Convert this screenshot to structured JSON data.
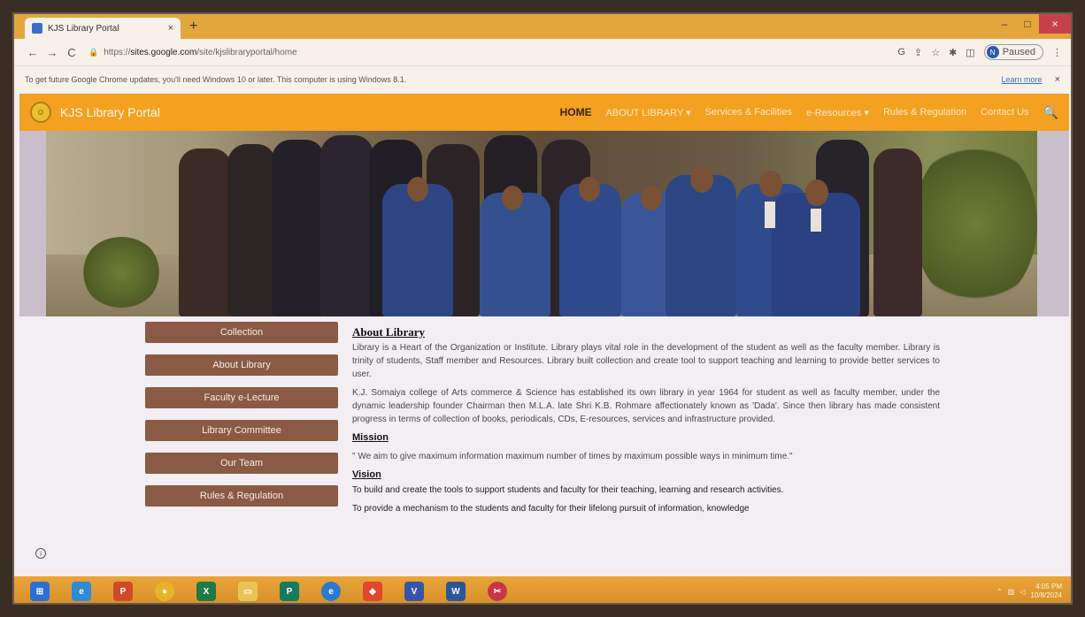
{
  "browser": {
    "tab_title": "KJS Library Portal",
    "tab_close": "×",
    "new_tab": "+",
    "win_minimize": "–",
    "win_maximize": "□",
    "win_close": "×",
    "url_prefix": "https://",
    "url_domain": "sites.google.com",
    "url_path": "/site/kjslibraryportal/home",
    "profile_initial": "N",
    "profile_status": "Paused",
    "info_message": "To get future Google Chrome updates, you'll need Windows 10 or later. This computer is using Windows 8.1.",
    "learn_more": "Learn more"
  },
  "site": {
    "name": "KJS Library Portal",
    "menu": {
      "home": "HOME",
      "about": "ABOUT LIBRARY ▾",
      "services": "Services & Facilities",
      "eresources": "e-Resources ▾",
      "rules": "Rules & Regulation",
      "contact": "Contact Us"
    }
  },
  "sidebar": {
    "items": [
      {
        "label": "Collection"
      },
      {
        "label": "About Library"
      },
      {
        "label": "Faculty e-Lecture"
      },
      {
        "label": "Library Committee"
      },
      {
        "label": "Our Team"
      },
      {
        "label": "Rules & Regulation"
      }
    ]
  },
  "content": {
    "about_heading": "About Library",
    "about_p1": "Library is a Heart of the Organization or Institute. Library plays vital role in the development of the student as well as the faculty member. Library is trinity of students, Staff member and Resources. Library built collection and create tool to support teaching and learning to provide better services to user.",
    "about_p2": "K.J. Somaiya college of Arts commerce & Science has established its own library in year 1964 for student as well as faculty member, under the dynamic leadership founder Chairman then M.L.A. late Shri K.B. Rohmare affectionately known as 'Dada'. Since then library has made consistent progress in terms of collection of books, periodicals, CDs, E-resources, services and infrastructure provided.",
    "mission_heading": "Mission",
    "mission_text": "\" We aim to give maximum information maximum number of times by maximum possible ways in minimum time.\"",
    "vision_heading": "Vision",
    "vision_p1": "To build and create the tools to support students and faculty for their teaching, learning and research activities.",
    "vision_p2": "To provide a mechanism to the students and faculty for their lifelong pursuit of information, knowledge"
  },
  "taskbar": {
    "apps": [
      "windows-start",
      "internet-explorer",
      "powerpoint",
      "chrome",
      "excel",
      "file-explorer",
      "publisher",
      "edge",
      "anydesk",
      "visio",
      "word",
      "snip"
    ],
    "time": "4:05 PM",
    "date": "10/8/2024"
  },
  "colors": {
    "header": "#f4a020",
    "sidebar_button": "#8b5a44",
    "taskbar": "#e0992f"
  }
}
